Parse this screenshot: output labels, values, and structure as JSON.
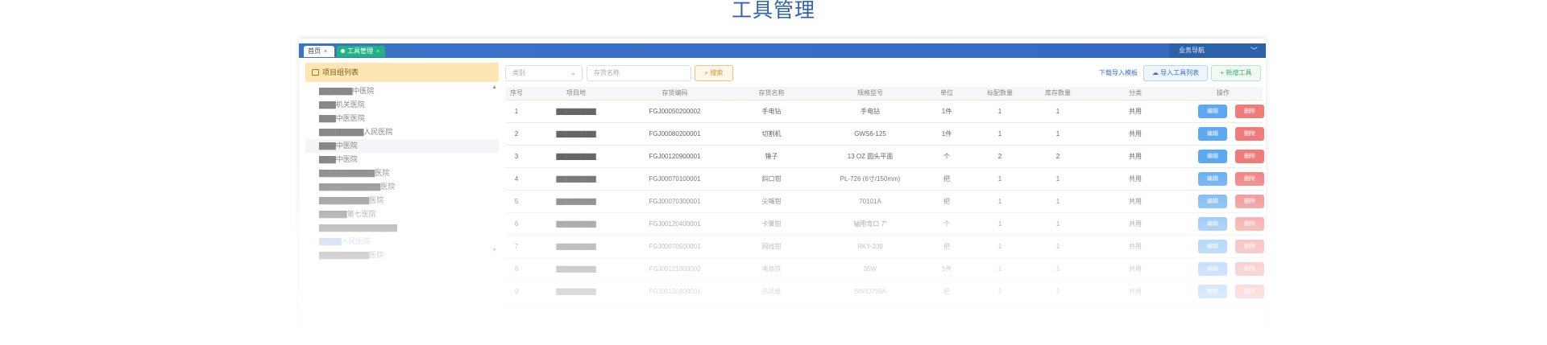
{
  "page": {
    "title": "工具管理"
  },
  "tabs": [
    {
      "label": "首页",
      "close": "×"
    },
    {
      "label": "工具管理",
      "close": "×"
    }
  ],
  "nav": {
    "label": "业务导航",
    "chevron": "﹀"
  },
  "left": {
    "header": "项目组列表",
    "items": [
      "▇▇▇▇▇▇中医院",
      "▇▇▇机关医院",
      "▇▇▇中医医院",
      "▇▇▇▇▇▇▇▇人民医院",
      "▇▇▇中医院",
      "▇▇▇中医院",
      "▇▇▇▇▇▇▇▇▇▇医院",
      "▇▇▇▇▇▇▇▇▇▇▇医院",
      "▇▇▇▇▇▇▇▇▇医院",
      "▇▇▇▇▇第七医院",
      "▇▇▇▇▇▇▇▇▇▇▇▇▇▇",
      "▇▇▇▇人民医院",
      "▇▇▇▇▇▇▇▇▇医院"
    ],
    "scroll_up": "▲",
    "scroll_down": "▼"
  },
  "toolbar": {
    "category_placeholder": "类别",
    "name_placeholder": "存货名称",
    "search_label": "搜索",
    "download_label": "下载导入模板",
    "import_label": "导入工具列表",
    "new_label": "+ 新增工具"
  },
  "table": {
    "headers": [
      "序号",
      "项目地",
      "存货编码",
      "存货名称",
      "规格型号",
      "单位",
      "标配数量",
      "库存数量",
      "分类",
      "操作"
    ],
    "edit_label": "编辑",
    "delete_label": "删除",
    "rows": [
      {
        "no": "1",
        "project": "▇▇▇▇▇▇▇▇",
        "code": "FGJ00050200002",
        "name": "手电钻",
        "spec": "手电钻",
        "unit": "1件",
        "std": "1",
        "stock": "1",
        "cat": "共用"
      },
      {
        "no": "2",
        "project": "▇▇▇▇▇▇▇▇",
        "code": "FGJ00080200001",
        "name": "切割机",
        "spec": "GWS6-125",
        "unit": "1件",
        "std": "1",
        "stock": "1",
        "cat": "共用"
      },
      {
        "no": "3",
        "project": "▇▇▇▇▇▇▇▇",
        "code": "FGJ00120900001",
        "name": "锤子",
        "spec": "13 OZ 圆头平面",
        "unit": "个",
        "std": "2",
        "stock": "2",
        "cat": "共用"
      },
      {
        "no": "4",
        "project": "▇▇▇▇▇▇▇▇",
        "code": "FGJ00070100001",
        "name": "斜口钳",
        "spec": "PL-726 (6寸/150mm)",
        "unit": "把",
        "std": "1",
        "stock": "1",
        "cat": "共用"
      },
      {
        "no": "5",
        "project": "▇▇▇▇▇▇▇▇",
        "code": "FGJ00070300001",
        "name": "尖嘴钳",
        "spec": "70101A",
        "unit": "把",
        "std": "1",
        "stock": "1",
        "cat": "共用"
      },
      {
        "no": "6",
        "project": "▇▇▇▇▇▇▇▇",
        "code": "FGJ00120400001",
        "name": "卡簧钳",
        "spec": "轴用弯口 7\"",
        "unit": "个",
        "std": "1",
        "stock": "1",
        "cat": "共用"
      },
      {
        "no": "7",
        "project": "▇▇▇▇▇▇▇▇",
        "code": "FGJ00070500001",
        "name": "网线钳",
        "spec": "RKY-338",
        "unit": "把",
        "std": "1",
        "stock": "1",
        "cat": "共用"
      },
      {
        "no": "8",
        "project": "▇▇▇▇▇▇▇▇",
        "code": "FGJ00121000002",
        "name": "电烙铁",
        "spec": "35W",
        "unit": "1件",
        "std": "1",
        "stock": "1",
        "cat": "共用"
      },
      {
        "no": "9",
        "project": "▇▇▇▇▇▇▇▇",
        "code": "FGJ00120800001",
        "name": "热风枪",
        "spec": "BW-D798A",
        "unit": "把",
        "std": "1",
        "stock": "1",
        "cat": "共用"
      }
    ]
  }
}
